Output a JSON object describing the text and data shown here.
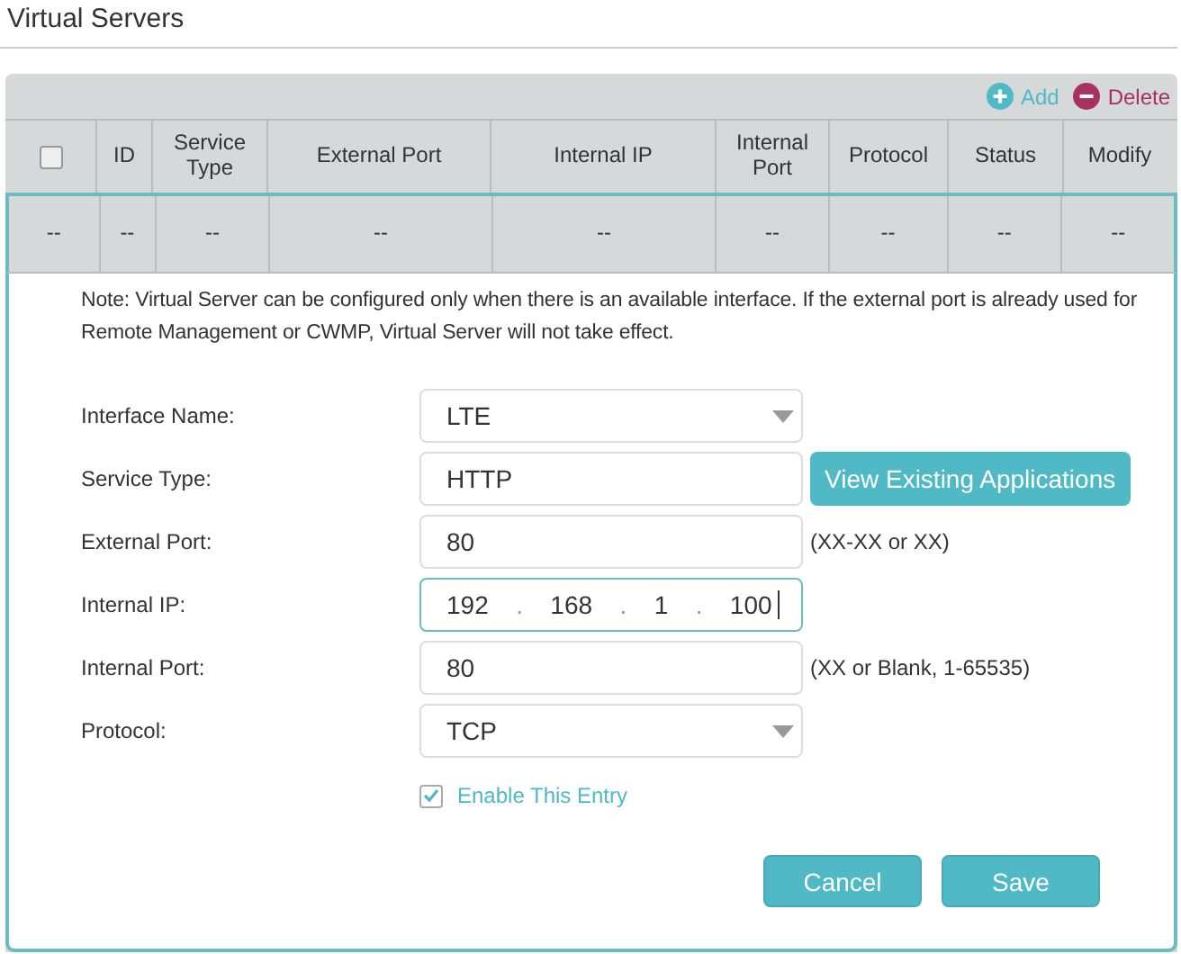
{
  "title": "Virtual Servers",
  "toolbar": [
    {
      "kind": "add",
      "label": "Add"
    },
    {
      "kind": "delete",
      "label": "Delete"
    }
  ],
  "table": {
    "header_checkbox": {
      "checked": false
    },
    "columns": [
      "",
      "ID",
      "Service Type",
      "External Port",
      "Internal IP",
      "Internal Port",
      "Protocol",
      "Status",
      "Modify"
    ],
    "rows": [
      {
        "selected": true,
        "cells": [
          "--",
          "--",
          "--",
          "--",
          "--",
          "--",
          "--",
          "--",
          "--"
        ]
      }
    ]
  },
  "note": "Note: Virtual Server can be configured only when there is an available interface. If the external port is already used for Remote Management or CWMP, Virtual Server will not take effect.",
  "fields": [
    {
      "label": "Interface Name:",
      "kind": "select",
      "value": "LTE",
      "focused": false
    },
    {
      "label": "Service Type:",
      "kind": "text",
      "value": "HTTP",
      "focused": false,
      "button": "View Existing Applications"
    },
    {
      "label": "External Port:",
      "kind": "text",
      "value": "80",
      "focused": false,
      "hint": "(XX-XX or XX)"
    },
    {
      "label": "Internal IP:",
      "kind": "ip",
      "octets": [
        "192",
        "168",
        "1",
        "100"
      ],
      "separator": ".",
      "focused": true
    },
    {
      "label": "Internal Port:",
      "kind": "text",
      "value": "80",
      "focused": false,
      "hint": "(XX or Blank, 1-65535)"
    },
    {
      "label": "Protocol:",
      "kind": "select",
      "value": "TCP",
      "focused": false
    }
  ],
  "enable_entry": {
    "label": "Enable This Entry",
    "checked": true
  },
  "buttons": [
    "Cancel",
    "Save"
  ]
}
